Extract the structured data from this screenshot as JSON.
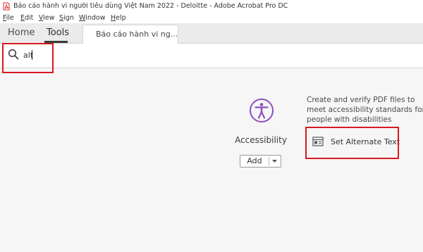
{
  "window": {
    "title": "Báo cáo hành vi người tiêu dùng Việt Nam 2022 - Deloitte - Adobe Acrobat Pro DC"
  },
  "menu": [
    {
      "underline": "F",
      "rest": "ile"
    },
    {
      "underline": "E",
      "rest": "dit"
    },
    {
      "underline": "V",
      "rest": "iew"
    },
    {
      "underline": "S",
      "rest": "ign"
    },
    {
      "underline": "W",
      "rest": "indow"
    },
    {
      "underline": "H",
      "rest": "elp"
    }
  ],
  "tabs": {
    "home": "Home",
    "tools": "Tools",
    "document": "Báo cáo hành vi ng..."
  },
  "search": {
    "value": "alt",
    "placeholder": ""
  },
  "tool": {
    "name": "Accessibility",
    "add_label": "Add",
    "description": [
      "Create and verify PDF files to",
      "meet accessibility standards for",
      "people with disabilities"
    ],
    "action_label": "Set Alternate Text",
    "icon_color": "#8e4fc0"
  },
  "colors": {
    "highlight": "#d71920",
    "acrobat_red": "#d9261c"
  }
}
